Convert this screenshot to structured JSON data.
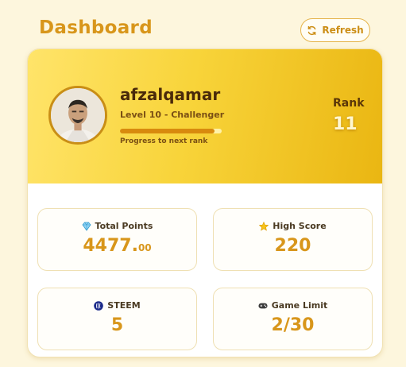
{
  "header": {
    "title": "Dashboard",
    "refresh_label": "Refresh"
  },
  "profile": {
    "username": "afzalqamar",
    "level": "Level 10 - Challenger",
    "progress_label": "Progress to next rank",
    "progress_fraction": 0.93,
    "rank_label": "Rank",
    "rank_value": "11"
  },
  "stats": {
    "total_points": {
      "label": "Total Points",
      "value_main": "4477.",
      "value_decimal": "00",
      "icon": "gem-icon"
    },
    "high_score": {
      "label": "High Score",
      "value": "220",
      "icon": "star-icon"
    },
    "steem": {
      "label": "STEEM",
      "value": "5",
      "icon": "steem-icon"
    },
    "game_limit": {
      "label": "Game Limit",
      "value": "2/30",
      "icon": "gamepad-icon"
    }
  },
  "colors": {
    "accent": "#d8961b",
    "hero_start": "#ffe46a",
    "hero_end": "#eab612",
    "progress": "#d88a0e"
  }
}
